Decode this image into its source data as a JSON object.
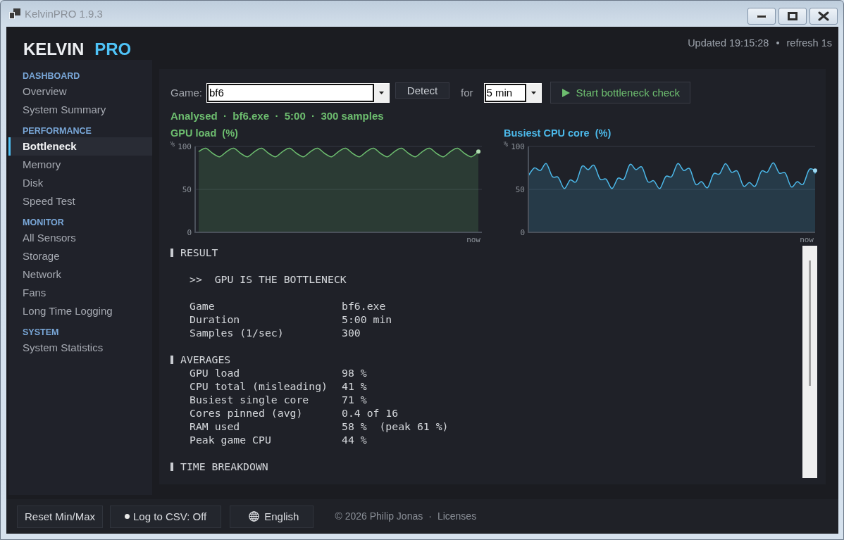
{
  "window": {
    "title": "KelvinPRO 1.9.3"
  },
  "header": {
    "brand": {
      "name": "KELVIN",
      "edition": "PRO"
    },
    "status": [
      "Updated 19:15:28",
      "refresh 1s"
    ],
    "status_separator": "•"
  },
  "sidebar": {
    "groups": [
      {
        "title": "DASHBOARD",
        "items": [
          {
            "label": "Overview",
            "selected": false
          },
          {
            "label": "System Summary",
            "selected": false
          }
        ]
      },
      {
        "title": "PERFORMANCE",
        "items": [
          {
            "label": "Bottleneck",
            "selected": true
          },
          {
            "label": "Memory",
            "selected": false
          },
          {
            "label": "Disk",
            "selected": false
          },
          {
            "label": "Speed Test",
            "selected": false
          }
        ]
      },
      {
        "title": "MONITOR",
        "items": [
          {
            "label": "All Sensors",
            "selected": false
          },
          {
            "label": "Storage",
            "selected": false
          },
          {
            "label": "Network",
            "selected": false
          },
          {
            "label": "Fans",
            "selected": false
          },
          {
            "label": "Long Time Logging",
            "selected": false
          }
        ]
      },
      {
        "title": "SYSTEM",
        "items": [
          {
            "label": "System Statistics",
            "selected": false
          }
        ]
      }
    ]
  },
  "controls": {
    "game_label": "Game:",
    "game_value": "bf6",
    "detect_button": "Detect",
    "duration_label": "for",
    "duration_value": "5 min",
    "start_button": "Start bottleneck check"
  },
  "summary": "Analysed  ·  bf6.exe  ·  5:00  ·  300 samples",
  "charts": [
    {
      "chart_data": {
        "type": "area",
        "title": "GPU load  (%)",
        "ylabel": "%",
        "ylim": [
          0,
          100
        ],
        "yticks": [
          0,
          50,
          100
        ],
        "annotations": [
          {
            "text": "now"
          }
        ],
        "series": [
          {
            "color": "#6dbd6f",
            "values": [
              94,
              98,
              92,
              88,
              94,
              98,
              92,
              88,
              94,
              98,
              92,
              88,
              94,
              98,
              92,
              88,
              94,
              98,
              92,
              88,
              94,
              98,
              92,
              88,
              94,
              98,
              92,
              88,
              94,
              98,
              92,
              88,
              94,
              98,
              92,
              88,
              94,
              98,
              92,
              88,
              94
            ]
          }
        ]
      }
    },
    {
      "chart_data": {
        "type": "area",
        "title": "Busiest CPU core  (%)",
        "ylabel": "%",
        "ylim": [
          0,
          100
        ],
        "yticks": [
          0,
          50,
          100
        ],
        "annotations": [
          {
            "text": "now"
          }
        ],
        "series": [
          {
            "color": "#4cb9ea",
            "values": [
              66,
              75,
              72,
              80,
              65,
              64,
              51,
              61,
              59,
              77,
              73,
              78,
              62,
              62,
              51,
              63,
              62,
              79,
              73,
              76,
              59,
              60,
              51,
              65,
              65,
              80,
              72,
              74,
              56,
              59,
              52,
              68,
              68,
              80,
              70,
              71,
              54,
              58,
              54,
              71,
              70,
              81,
              69,
              69,
              53,
              59,
              56,
              73,
              72
            ]
          }
        ]
      }
    }
  ],
  "result": {
    "sections": [
      {
        "title": "RESULT",
        "verdict": ">>  GPU IS THE BOTTLENECK",
        "rows": [
          {
            "label": "Game",
            "value": "bf6.exe"
          },
          {
            "label": "Duration",
            "value": "5:00 min"
          },
          {
            "label": "Samples (1/sec)",
            "value": "300"
          }
        ]
      },
      {
        "title": "AVERAGES",
        "rows": [
          {
            "label": "GPU load",
            "value": "98 %"
          },
          {
            "label": "CPU total (misleading)",
            "value": "41 %"
          },
          {
            "label": "Busiest single core",
            "value": "71 %"
          },
          {
            "label": "Cores pinned (avg)",
            "value": "0.4 of 16"
          },
          {
            "label": "RAM used",
            "value": "58 %  (peak 61 %)"
          },
          {
            "label": "Peak game CPU",
            "value": "44 %"
          }
        ]
      },
      {
        "title": "TIME BREAKDOWN"
      }
    ]
  },
  "footer": {
    "buttons": [
      {
        "kind": "plain",
        "label": "Reset Min/Max"
      },
      {
        "kind": "toggle",
        "label": "Log to CSV: Off"
      },
      {
        "kind": "language",
        "label": "English"
      }
    ],
    "copyright": "© 2026 Philip Jonas",
    "separator": "·",
    "link": "Licenses"
  }
}
